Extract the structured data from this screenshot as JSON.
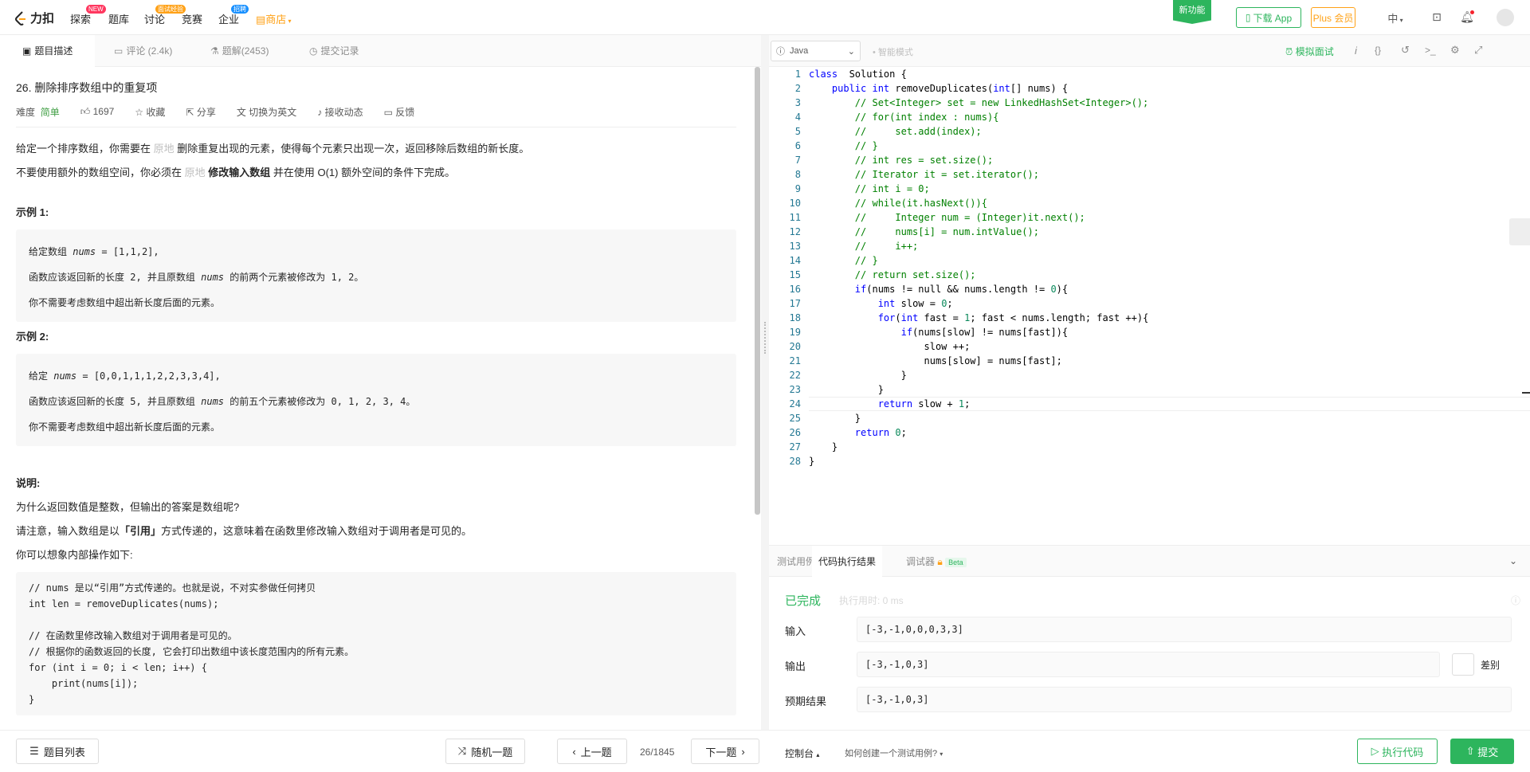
{
  "nav": {
    "logo": "力扣",
    "items": [
      "探索",
      "题库",
      "讨论",
      "竞赛",
      "企业"
    ],
    "store": "商店",
    "badge_new": "NEW",
    "badge_discuss": "面试经验",
    "badge_company": "招聘",
    "new_feature": "新功能",
    "download": "下载 App",
    "plus": "Plus 会员",
    "lang": "中"
  },
  "left_tabs": [
    "题目描述",
    "评论 (2.4k)",
    "题解(2453)",
    "提交记录"
  ],
  "problem": {
    "title": "26. 删除排序数组中的重复项",
    "difficulty_label": "难度",
    "difficulty": "简单",
    "likes": "1697",
    "collect": "收藏",
    "share": "分享",
    "switch_en": "切换为英文",
    "follow": "接收动态",
    "feedback": "反馈",
    "p1_a": "给定一个排序数组，你需要在 ",
    "p1_b": "原地",
    "p1_c": " 删除重复出现的元素，使得每个元素只出现一次，返回移除后数组的新长度。",
    "p2_a": "不要使用额外的数组空间，你必须在 ",
    "p2_b": "原地",
    "p2_c": " 修改输入数组",
    "p2_d": " 并在使用 O(1) 额外空间的条件下完成。",
    "ex1_title": "示例 1:",
    "ex1_l1_a": "给定数组 ",
    "ex1_l1_b": "nums",
    "ex1_l1_c": " = [1,1,2],",
    "ex1_l2_a": "函数应该返回新的长度 2, 并且原数组 ",
    "ex1_l2_b": "nums",
    "ex1_l2_c": " 的前两个元素被修改为 1, 2。",
    "ex1_l3": "你不需要考虑数组中超出新长度后面的元素。",
    "ex2_title": "示例 2:",
    "ex2_l1_a": "给定 ",
    "ex2_l1_b": "nums",
    "ex2_l1_c": " = [0,0,1,1,1,2,2,3,3,4],",
    "ex2_l2_a": "函数应该返回新的长度 5, 并且原数组 ",
    "ex2_l2_b": "nums",
    "ex2_l2_c": " 的前五个元素被修改为 0, 1, 2, 3, 4。",
    "ex2_l3": "你不需要考虑数组中超出新长度后面的元素。",
    "note_title": "说明:",
    "note1": "为什么返回数值是整数，但输出的答案是数组呢?",
    "note2_a": "请注意，输入数组是以",
    "note2_b": "「引用」",
    "note2_c": "方式传递的，这意味着在函数里修改输入数组对于调用者是可见的。",
    "note3": "你可以想象内部操作如下:",
    "code_lines": [
      "// nums 是以“引用”方式传递的。也就是说，不对实参做任何拷贝",
      "int len = removeDuplicates(nums);",
      "",
      "// 在函数里修改输入数组对于调用者是可见的。",
      "// 根据你的函数返回的长度, 它会打印出数组中该长度范围内的所有元素。",
      "for (int i = 0; i < len; i++) {",
      "    print(nums[i]);",
      "}"
    ]
  },
  "editor": {
    "language": "Java",
    "smart_mode": "智能模式",
    "mock": "模拟面试"
  },
  "bottom_tabs": [
    "测试用例",
    "代码执行结果",
    "调试器"
  ],
  "beta": "Beta",
  "result": {
    "status": "已完成",
    "time": "执行用时: 0 ms",
    "input_label": "输入",
    "input": "[-3,-1,0,0,0,3,3]",
    "output_label": "输出",
    "output": "[-3,-1,0,3]",
    "expected_label": "预期结果",
    "expected": "[-3,-1,0,3]",
    "diff": "差别"
  },
  "bottom_bar": {
    "list": "题目列表",
    "random": "随机一题",
    "prev": "上一题",
    "page": "26/1845",
    "next": "下一题",
    "console": "控制台",
    "howto": "如何创建一个测试用例?",
    "run": "执行代码",
    "submit": "提交"
  },
  "colors": {
    "green": "#2db55d",
    "orange": "#ffa116",
    "easy": "#43a047"
  }
}
